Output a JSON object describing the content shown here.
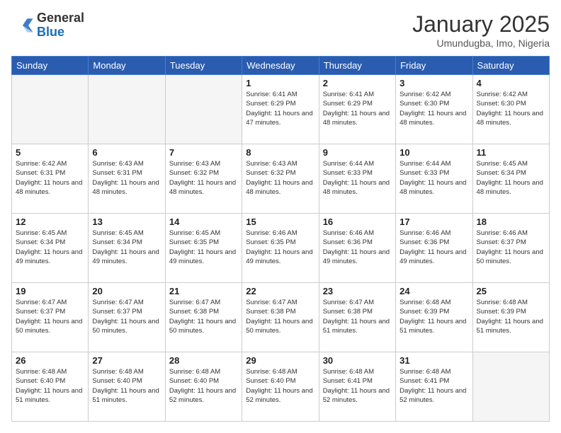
{
  "logo": {
    "general": "General",
    "blue": "Blue"
  },
  "header": {
    "month": "January 2025",
    "location": "Umundugba, Imo, Nigeria"
  },
  "days_of_week": [
    "Sunday",
    "Monday",
    "Tuesday",
    "Wednesday",
    "Thursday",
    "Friday",
    "Saturday"
  ],
  "weeks": [
    [
      {
        "day": "",
        "empty": true
      },
      {
        "day": "",
        "empty": true
      },
      {
        "day": "",
        "empty": true
      },
      {
        "day": "1",
        "sunrise": "6:41 AM",
        "sunset": "6:29 PM",
        "daylight": "11 hours and 47 minutes."
      },
      {
        "day": "2",
        "sunrise": "6:41 AM",
        "sunset": "6:29 PM",
        "daylight": "11 hours and 48 minutes."
      },
      {
        "day": "3",
        "sunrise": "6:42 AM",
        "sunset": "6:30 PM",
        "daylight": "11 hours and 48 minutes."
      },
      {
        "day": "4",
        "sunrise": "6:42 AM",
        "sunset": "6:30 PM",
        "daylight": "11 hours and 48 minutes."
      }
    ],
    [
      {
        "day": "5",
        "sunrise": "6:42 AM",
        "sunset": "6:31 PM",
        "daylight": "11 hours and 48 minutes."
      },
      {
        "day": "6",
        "sunrise": "6:43 AM",
        "sunset": "6:31 PM",
        "daylight": "11 hours and 48 minutes."
      },
      {
        "day": "7",
        "sunrise": "6:43 AM",
        "sunset": "6:32 PM",
        "daylight": "11 hours and 48 minutes."
      },
      {
        "day": "8",
        "sunrise": "6:43 AM",
        "sunset": "6:32 PM",
        "daylight": "11 hours and 48 minutes."
      },
      {
        "day": "9",
        "sunrise": "6:44 AM",
        "sunset": "6:33 PM",
        "daylight": "11 hours and 48 minutes."
      },
      {
        "day": "10",
        "sunrise": "6:44 AM",
        "sunset": "6:33 PM",
        "daylight": "11 hours and 48 minutes."
      },
      {
        "day": "11",
        "sunrise": "6:45 AM",
        "sunset": "6:34 PM",
        "daylight": "11 hours and 48 minutes."
      }
    ],
    [
      {
        "day": "12",
        "sunrise": "6:45 AM",
        "sunset": "6:34 PM",
        "daylight": "11 hours and 49 minutes."
      },
      {
        "day": "13",
        "sunrise": "6:45 AM",
        "sunset": "6:34 PM",
        "daylight": "11 hours and 49 minutes."
      },
      {
        "day": "14",
        "sunrise": "6:45 AM",
        "sunset": "6:35 PM",
        "daylight": "11 hours and 49 minutes."
      },
      {
        "day": "15",
        "sunrise": "6:46 AM",
        "sunset": "6:35 PM",
        "daylight": "11 hours and 49 minutes."
      },
      {
        "day": "16",
        "sunrise": "6:46 AM",
        "sunset": "6:36 PM",
        "daylight": "11 hours and 49 minutes."
      },
      {
        "day": "17",
        "sunrise": "6:46 AM",
        "sunset": "6:36 PM",
        "daylight": "11 hours and 49 minutes."
      },
      {
        "day": "18",
        "sunrise": "6:46 AM",
        "sunset": "6:37 PM",
        "daylight": "11 hours and 50 minutes."
      }
    ],
    [
      {
        "day": "19",
        "sunrise": "6:47 AM",
        "sunset": "6:37 PM",
        "daylight": "11 hours and 50 minutes."
      },
      {
        "day": "20",
        "sunrise": "6:47 AM",
        "sunset": "6:37 PM",
        "daylight": "11 hours and 50 minutes."
      },
      {
        "day": "21",
        "sunrise": "6:47 AM",
        "sunset": "6:38 PM",
        "daylight": "11 hours and 50 minutes."
      },
      {
        "day": "22",
        "sunrise": "6:47 AM",
        "sunset": "6:38 PM",
        "daylight": "11 hours and 50 minutes."
      },
      {
        "day": "23",
        "sunrise": "6:47 AM",
        "sunset": "6:38 PM",
        "daylight": "11 hours and 51 minutes."
      },
      {
        "day": "24",
        "sunrise": "6:48 AM",
        "sunset": "6:39 PM",
        "daylight": "11 hours and 51 minutes."
      },
      {
        "day": "25",
        "sunrise": "6:48 AM",
        "sunset": "6:39 PM",
        "daylight": "11 hours and 51 minutes."
      }
    ],
    [
      {
        "day": "26",
        "sunrise": "6:48 AM",
        "sunset": "6:40 PM",
        "daylight": "11 hours and 51 minutes."
      },
      {
        "day": "27",
        "sunrise": "6:48 AM",
        "sunset": "6:40 PM",
        "daylight": "11 hours and 51 minutes."
      },
      {
        "day": "28",
        "sunrise": "6:48 AM",
        "sunset": "6:40 PM",
        "daylight": "11 hours and 52 minutes."
      },
      {
        "day": "29",
        "sunrise": "6:48 AM",
        "sunset": "6:40 PM",
        "daylight": "11 hours and 52 minutes."
      },
      {
        "day": "30",
        "sunrise": "6:48 AM",
        "sunset": "6:41 PM",
        "daylight": "11 hours and 52 minutes."
      },
      {
        "day": "31",
        "sunrise": "6:48 AM",
        "sunset": "6:41 PM",
        "daylight": "11 hours and 52 minutes."
      },
      {
        "day": "",
        "empty": true
      }
    ]
  ],
  "labels": {
    "sunrise": "Sunrise:",
    "sunset": "Sunset:",
    "daylight": "Daylight:"
  }
}
